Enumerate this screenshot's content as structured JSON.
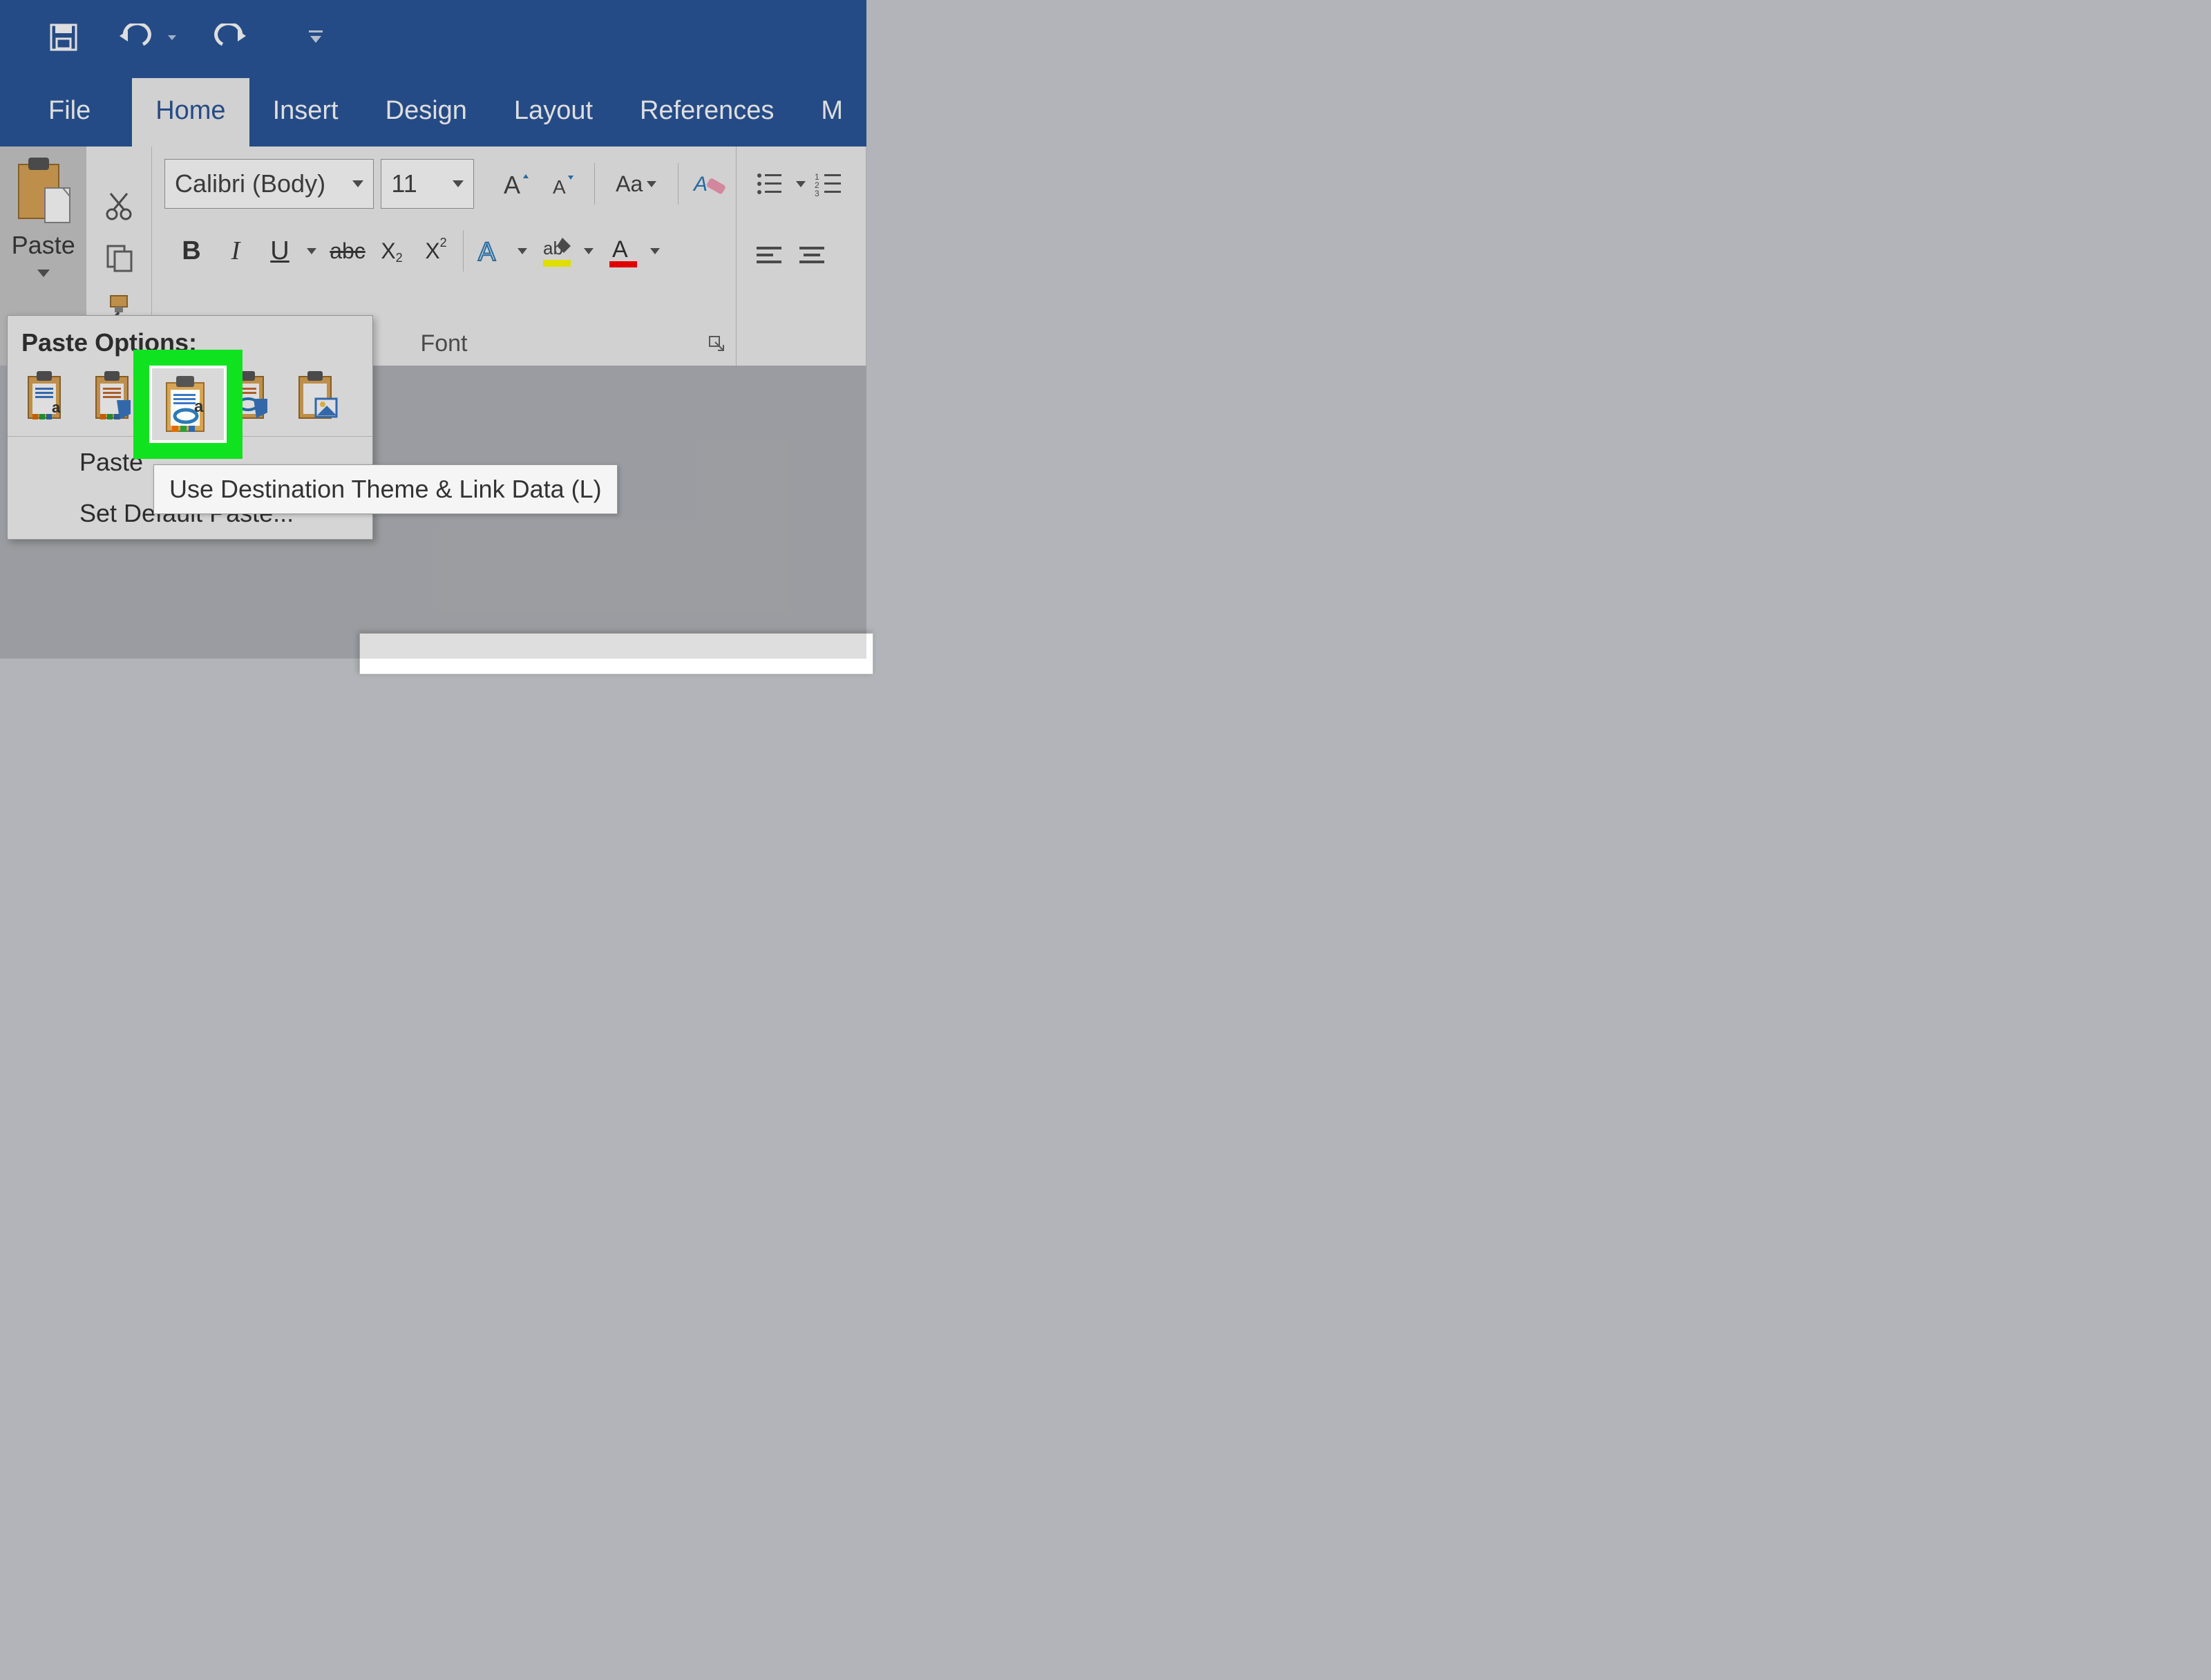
{
  "qat": {
    "save": "save-icon",
    "undo": "undo-icon",
    "redo": "redo-icon",
    "customize": "customize-qat"
  },
  "tabs": {
    "file": "File",
    "home": "Home",
    "insert": "Insert",
    "design": "Design",
    "layout": "Layout",
    "references": "References",
    "more": "M"
  },
  "clipboard": {
    "paste_label": "Paste"
  },
  "font": {
    "name": "Calibri (Body)",
    "size": "11",
    "group_label": "Font"
  },
  "paste_menu": {
    "header": "Paste Options:",
    "paste_special": "Paste",
    "set_default": "Set Default Paste..."
  },
  "tooltip": {
    "text": "Use Destination Theme & Link Data (L)"
  },
  "colors": {
    "highlight": "#0fe320",
    "ribbon_blue": "#2b579a"
  }
}
